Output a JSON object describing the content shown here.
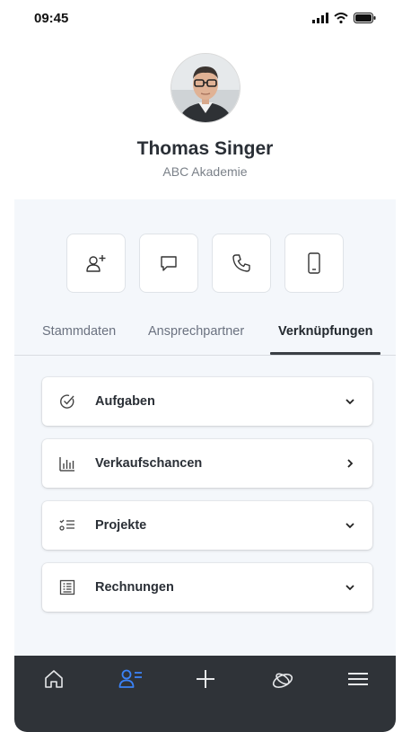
{
  "status": {
    "time": "09:45",
    "icons": [
      "signal-icon",
      "wifi-icon",
      "battery-icon"
    ]
  },
  "profile": {
    "name": "Thomas Singer",
    "organization": "ABC Akademie"
  },
  "actions": [
    {
      "name": "add-contact-button",
      "icon": "add-person-icon"
    },
    {
      "name": "message-button",
      "icon": "chat-icon"
    },
    {
      "name": "call-button",
      "icon": "phone-icon"
    },
    {
      "name": "mobile-button",
      "icon": "mobile-icon"
    }
  ],
  "tabs": [
    {
      "label": "Stammdaten",
      "active": false
    },
    {
      "label": "Ansprechpartner",
      "active": false
    },
    {
      "label": "Verknüpfungen",
      "active": true
    }
  ],
  "list": [
    {
      "label": "Aufgaben",
      "icon": "check-circle-icon",
      "chevron": "chevron-down-icon"
    },
    {
      "label": "Verkaufschancen",
      "icon": "bar-chart-icon",
      "chevron": "chevron-right-icon"
    },
    {
      "label": "Projekte",
      "icon": "checklist-icon",
      "chevron": "chevron-down-icon"
    },
    {
      "label": "Rechnungen",
      "icon": "invoice-icon",
      "chevron": "chevron-down-icon"
    }
  ],
  "nav": [
    {
      "name": "nav-home",
      "icon": "home-icon",
      "active": false
    },
    {
      "name": "nav-contacts",
      "icon": "contacts-icon",
      "active": true
    },
    {
      "name": "nav-add",
      "icon": "plus-icon",
      "active": false
    },
    {
      "name": "nav-deals",
      "icon": "deals-icon",
      "active": false
    },
    {
      "name": "nav-menu",
      "icon": "menu-icon",
      "active": false
    }
  ],
  "colors": {
    "accent": "#3b82f6",
    "nav_background": "#2f3338",
    "content_background": "#f4f7fb"
  }
}
